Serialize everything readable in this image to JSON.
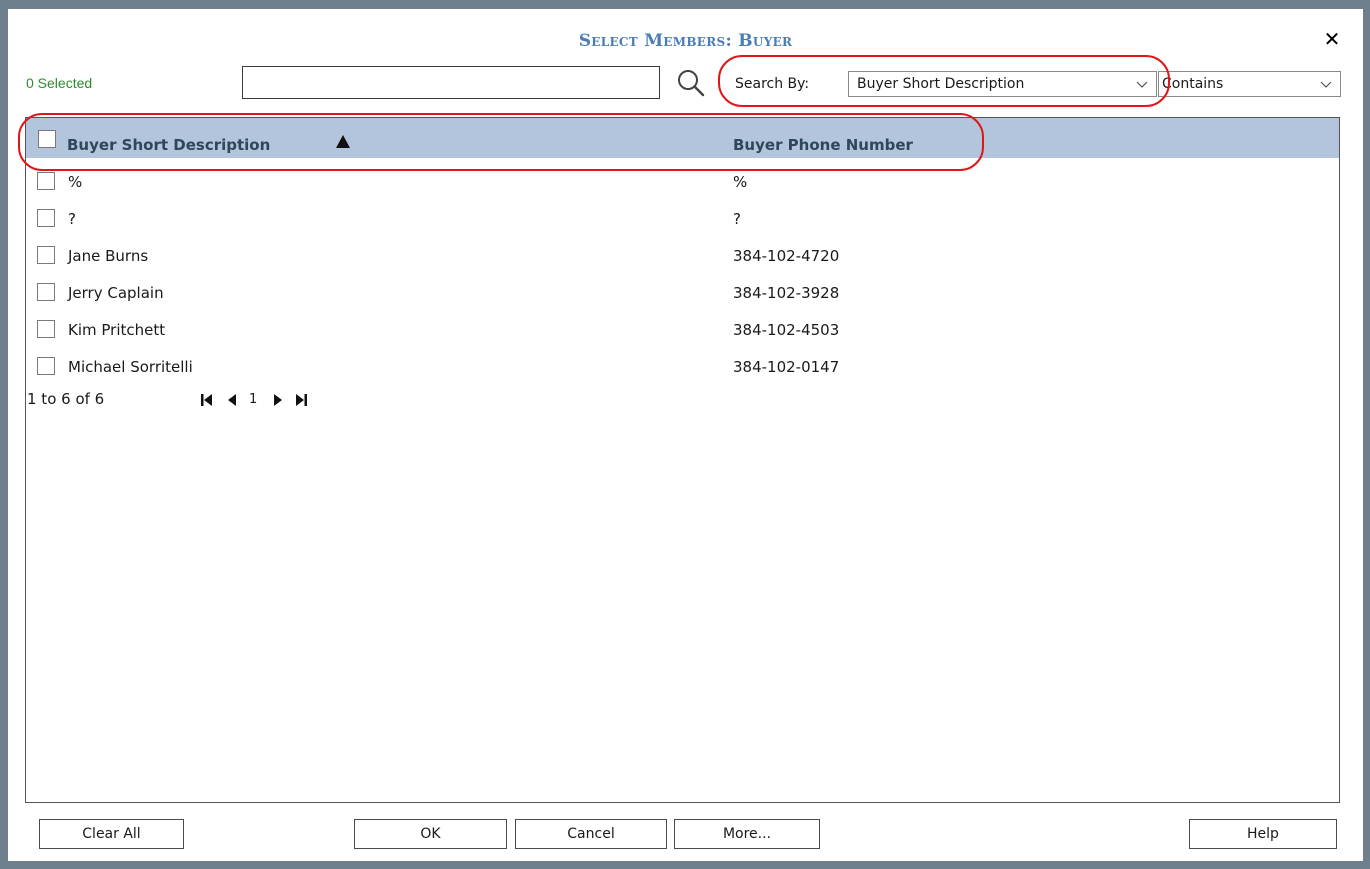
{
  "dialog": {
    "title": "Select Members: Buyer",
    "close_label": "✕",
    "selected_count": "0 Selected"
  },
  "search": {
    "value": "",
    "placeholder": "",
    "search_by_label": "Search By:",
    "search_by_value": "Buyer Short Description",
    "match_value": "Contains"
  },
  "grid": {
    "columns": [
      "Buyer Short Description",
      "Buyer Phone Number"
    ],
    "sort_column": "Buyer Short Description",
    "sort_direction": "ascending",
    "rows": [
      {
        "description": "%",
        "phone": "%"
      },
      {
        "description": "?",
        "phone": "?"
      },
      {
        "description": "Jane Burns",
        "phone": "384-102-4720"
      },
      {
        "description": "Jerry Caplain",
        "phone": "384-102-3928"
      },
      {
        "description": "Kim Pritchett",
        "phone": "384-102-4503"
      },
      {
        "description": "Michael Sorritelli",
        "phone": "384-102-0147"
      }
    ]
  },
  "pager": {
    "range_text": "1 to 6 of 6",
    "current_page": "1"
  },
  "buttons": {
    "clear_all": "Clear All",
    "ok": "OK",
    "cancel": "Cancel",
    "more": "More...",
    "help": "Help"
  },
  "colors": {
    "header_bg": "#b3c4dd",
    "title": "#4a7db5",
    "selected_count": "#2e8b2e",
    "highlight": "#e01717",
    "frame": "#6f7f8e"
  }
}
